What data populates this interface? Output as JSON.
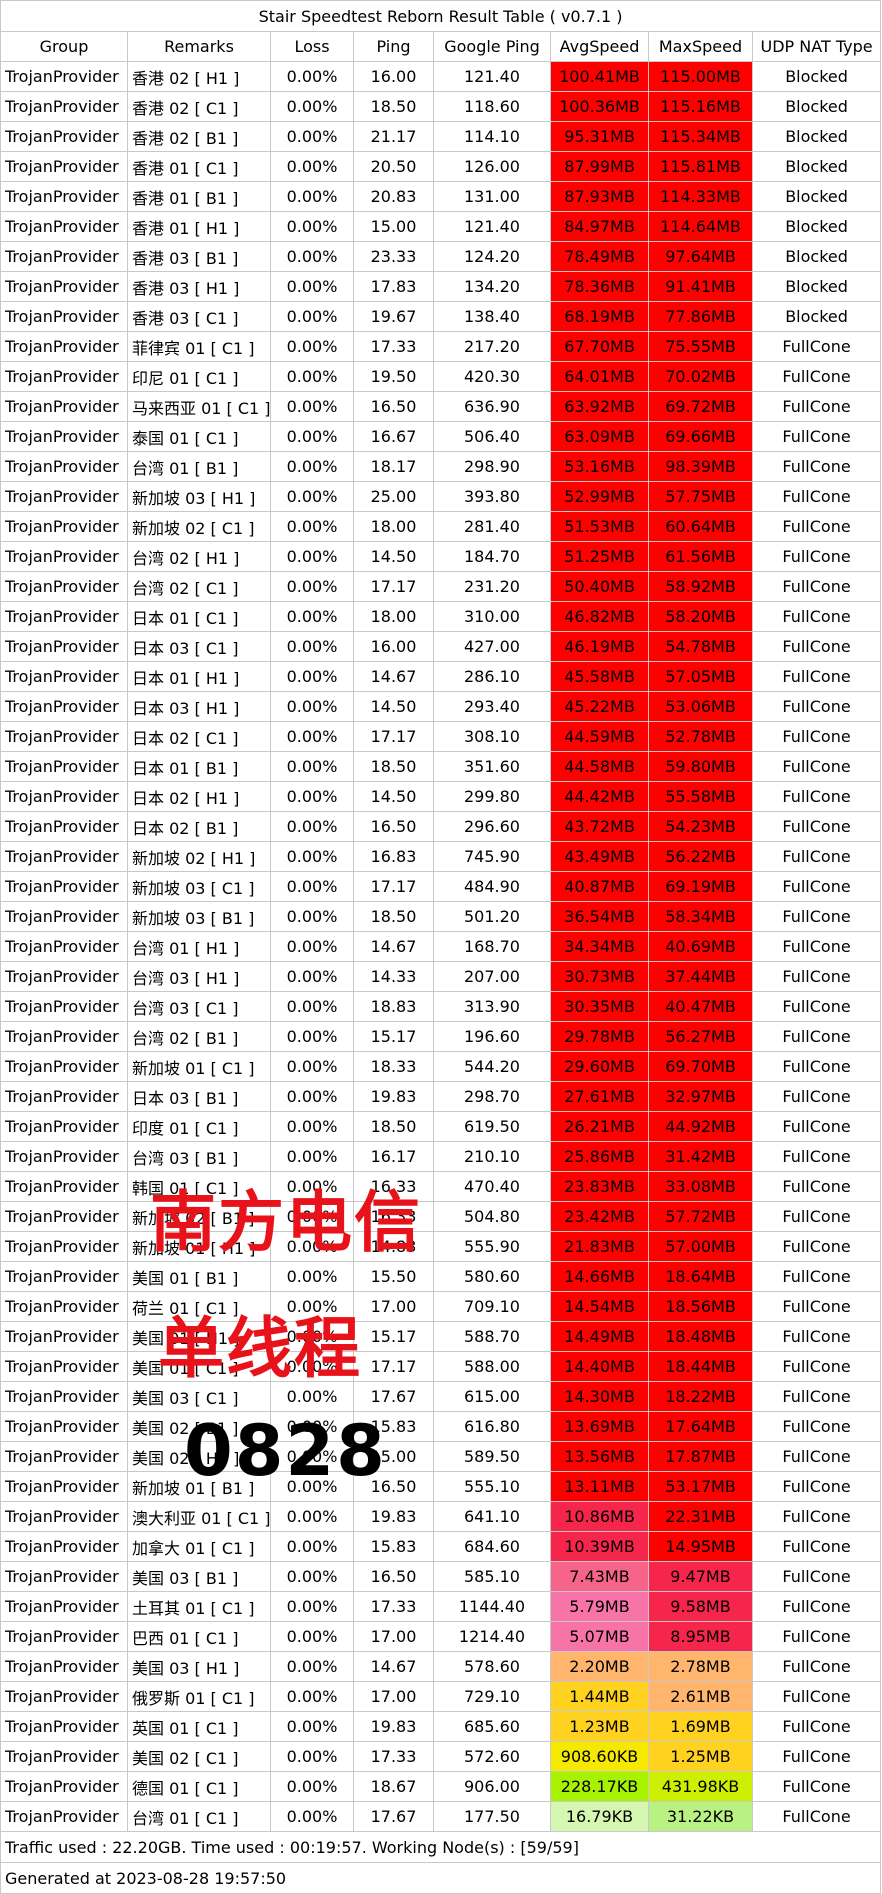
{
  "title": "Stair Speedtest Reborn Result Table ( v0.7.1 )",
  "columns": [
    "Group",
    "Remarks",
    "Loss",
    "Ping",
    "Google Ping",
    "AvgSpeed",
    "MaxSpeed",
    "UDP NAT Type"
  ],
  "rows": [
    {
      "group": "TrojanProvider",
      "remarks": "香港 02 [ H1 ]",
      "loss": "0.00%",
      "ping": "16.00",
      "gping": "121.40",
      "avg": "100.41MB",
      "max": "115.00MB",
      "nat": "Blocked",
      "avgColor": "#ff0000",
      "maxColor": "#ff0000"
    },
    {
      "group": "TrojanProvider",
      "remarks": "香港 02 [ C1 ]",
      "loss": "0.00%",
      "ping": "18.50",
      "gping": "118.60",
      "avg": "100.36MB",
      "max": "115.16MB",
      "nat": "Blocked",
      "avgColor": "#ff0000",
      "maxColor": "#ff0000"
    },
    {
      "group": "TrojanProvider",
      "remarks": "香港 02 [ B1 ]",
      "loss": "0.00%",
      "ping": "21.17",
      "gping": "114.10",
      "avg": "95.31MB",
      "max": "115.34MB",
      "nat": "Blocked",
      "avgColor": "#ff0000",
      "maxColor": "#ff0000"
    },
    {
      "group": "TrojanProvider",
      "remarks": "香港 01 [ C1 ]",
      "loss": "0.00%",
      "ping": "20.50",
      "gping": "126.00",
      "avg": "87.99MB",
      "max": "115.81MB",
      "nat": "Blocked",
      "avgColor": "#ff0000",
      "maxColor": "#ff0000"
    },
    {
      "group": "TrojanProvider",
      "remarks": "香港 01 [ B1 ]",
      "loss": "0.00%",
      "ping": "20.83",
      "gping": "131.00",
      "avg": "87.93MB",
      "max": "114.33MB",
      "nat": "Blocked",
      "avgColor": "#ff0000",
      "maxColor": "#ff0000"
    },
    {
      "group": "TrojanProvider",
      "remarks": "香港 01 [ H1 ]",
      "loss": "0.00%",
      "ping": "15.00",
      "gping": "121.40",
      "avg": "84.97MB",
      "max": "114.64MB",
      "nat": "Blocked",
      "avgColor": "#ff0000",
      "maxColor": "#ff0000"
    },
    {
      "group": "TrojanProvider",
      "remarks": "香港 03 [ B1 ]",
      "loss": "0.00%",
      "ping": "23.33",
      "gping": "124.20",
      "avg": "78.49MB",
      "max": "97.64MB",
      "nat": "Blocked",
      "avgColor": "#ff0000",
      "maxColor": "#ff0000"
    },
    {
      "group": "TrojanProvider",
      "remarks": "香港 03 [ H1 ]",
      "loss": "0.00%",
      "ping": "17.83",
      "gping": "134.20",
      "avg": "78.36MB",
      "max": "91.41MB",
      "nat": "Blocked",
      "avgColor": "#ff0000",
      "maxColor": "#ff0000"
    },
    {
      "group": "TrojanProvider",
      "remarks": "香港 03 [ C1 ]",
      "loss": "0.00%",
      "ping": "19.67",
      "gping": "138.40",
      "avg": "68.19MB",
      "max": "77.86MB",
      "nat": "Blocked",
      "avgColor": "#ff0000",
      "maxColor": "#ff0000"
    },
    {
      "group": "TrojanProvider",
      "remarks": "菲律宾 01 [ C1 ]",
      "loss": "0.00%",
      "ping": "17.33",
      "gping": "217.20",
      "avg": "67.70MB",
      "max": "75.55MB",
      "nat": "FullCone",
      "avgColor": "#ff0000",
      "maxColor": "#ff0000"
    },
    {
      "group": "TrojanProvider",
      "remarks": "印尼 01 [ C1 ]",
      "loss": "0.00%",
      "ping": "19.50",
      "gping": "420.30",
      "avg": "64.01MB",
      "max": "70.02MB",
      "nat": "FullCone",
      "avgColor": "#ff0000",
      "maxColor": "#ff0000"
    },
    {
      "group": "TrojanProvider",
      "remarks": "马来西亚 01 [ C1 ]",
      "loss": "0.00%",
      "ping": "16.50",
      "gping": "636.90",
      "avg": "63.92MB",
      "max": "69.72MB",
      "nat": "FullCone",
      "avgColor": "#ff0000",
      "maxColor": "#ff0000"
    },
    {
      "group": "TrojanProvider",
      "remarks": "泰国 01 [ C1 ]",
      "loss": "0.00%",
      "ping": "16.67",
      "gping": "506.40",
      "avg": "63.09MB",
      "max": "69.66MB",
      "nat": "FullCone",
      "avgColor": "#ff0000",
      "maxColor": "#ff0000"
    },
    {
      "group": "TrojanProvider",
      "remarks": "台湾 01 [ B1 ]",
      "loss": "0.00%",
      "ping": "18.17",
      "gping": "298.90",
      "avg": "53.16MB",
      "max": "98.39MB",
      "nat": "FullCone",
      "avgColor": "#ff0000",
      "maxColor": "#ff0000"
    },
    {
      "group": "TrojanProvider",
      "remarks": "新加坡 03 [ H1 ]",
      "loss": "0.00%",
      "ping": "25.00",
      "gping": "393.80",
      "avg": "52.99MB",
      "max": "57.75MB",
      "nat": "FullCone",
      "avgColor": "#ff0000",
      "maxColor": "#ff0000"
    },
    {
      "group": "TrojanProvider",
      "remarks": "新加坡 02 [ C1 ]",
      "loss": "0.00%",
      "ping": "18.00",
      "gping": "281.40",
      "avg": "51.53MB",
      "max": "60.64MB",
      "nat": "FullCone",
      "avgColor": "#ff0000",
      "maxColor": "#ff0000"
    },
    {
      "group": "TrojanProvider",
      "remarks": "台湾 02 [ H1 ]",
      "loss": "0.00%",
      "ping": "14.50",
      "gping": "184.70",
      "avg": "51.25MB",
      "max": "61.56MB",
      "nat": "FullCone",
      "avgColor": "#ff0000",
      "maxColor": "#ff0000"
    },
    {
      "group": "TrojanProvider",
      "remarks": "台湾 02 [ C1 ]",
      "loss": "0.00%",
      "ping": "17.17",
      "gping": "231.20",
      "avg": "50.40MB",
      "max": "58.92MB",
      "nat": "FullCone",
      "avgColor": "#ff0000",
      "maxColor": "#ff0000"
    },
    {
      "group": "TrojanProvider",
      "remarks": "日本 01 [ C1 ]",
      "loss": "0.00%",
      "ping": "18.00",
      "gping": "310.00",
      "avg": "46.82MB",
      "max": "58.20MB",
      "nat": "FullCone",
      "avgColor": "#ff0000",
      "maxColor": "#ff0000"
    },
    {
      "group": "TrojanProvider",
      "remarks": "日本 03 [ C1 ]",
      "loss": "0.00%",
      "ping": "16.00",
      "gping": "427.00",
      "avg": "46.19MB",
      "max": "54.78MB",
      "nat": "FullCone",
      "avgColor": "#ff0000",
      "maxColor": "#ff0000"
    },
    {
      "group": "TrojanProvider",
      "remarks": "日本 01 [ H1 ]",
      "loss": "0.00%",
      "ping": "14.67",
      "gping": "286.10",
      "avg": "45.58MB",
      "max": "57.05MB",
      "nat": "FullCone",
      "avgColor": "#ff0000",
      "maxColor": "#ff0000"
    },
    {
      "group": "TrojanProvider",
      "remarks": "日本 03 [ H1 ]",
      "loss": "0.00%",
      "ping": "14.50",
      "gping": "293.40",
      "avg": "45.22MB",
      "max": "53.06MB",
      "nat": "FullCone",
      "avgColor": "#ff0000",
      "maxColor": "#ff0000"
    },
    {
      "group": "TrojanProvider",
      "remarks": "日本 02 [ C1 ]",
      "loss": "0.00%",
      "ping": "17.17",
      "gping": "308.10",
      "avg": "44.59MB",
      "max": "52.78MB",
      "nat": "FullCone",
      "avgColor": "#ff0000",
      "maxColor": "#ff0000"
    },
    {
      "group": "TrojanProvider",
      "remarks": "日本 01 [ B1 ]",
      "loss": "0.00%",
      "ping": "18.50",
      "gping": "351.60",
      "avg": "44.58MB",
      "max": "59.80MB",
      "nat": "FullCone",
      "avgColor": "#ff0000",
      "maxColor": "#ff0000"
    },
    {
      "group": "TrojanProvider",
      "remarks": "日本 02 [ H1 ]",
      "loss": "0.00%",
      "ping": "14.50",
      "gping": "299.80",
      "avg": "44.42MB",
      "max": "55.58MB",
      "nat": "FullCone",
      "avgColor": "#ff0000",
      "maxColor": "#ff0000"
    },
    {
      "group": "TrojanProvider",
      "remarks": "日本 02 [ B1 ]",
      "loss": "0.00%",
      "ping": "16.50",
      "gping": "296.60",
      "avg": "43.72MB",
      "max": "54.23MB",
      "nat": "FullCone",
      "avgColor": "#ff0000",
      "maxColor": "#ff0000"
    },
    {
      "group": "TrojanProvider",
      "remarks": "新加坡 02 [ H1 ]",
      "loss": "0.00%",
      "ping": "16.83",
      "gping": "745.90",
      "avg": "43.49MB",
      "max": "56.22MB",
      "nat": "FullCone",
      "avgColor": "#ff0000",
      "maxColor": "#ff0000"
    },
    {
      "group": "TrojanProvider",
      "remarks": "新加坡 03 [ C1 ]",
      "loss": "0.00%",
      "ping": "17.17",
      "gping": "484.90",
      "avg": "40.87MB",
      "max": "69.19MB",
      "nat": "FullCone",
      "avgColor": "#ff0000",
      "maxColor": "#ff0000"
    },
    {
      "group": "TrojanProvider",
      "remarks": "新加坡 03 [ B1 ]",
      "loss": "0.00%",
      "ping": "18.50",
      "gping": "501.20",
      "avg": "36.54MB",
      "max": "58.34MB",
      "nat": "FullCone",
      "avgColor": "#ff0000",
      "maxColor": "#ff0000"
    },
    {
      "group": "TrojanProvider",
      "remarks": "台湾 01 [ H1 ]",
      "loss": "0.00%",
      "ping": "14.67",
      "gping": "168.70",
      "avg": "34.34MB",
      "max": "40.69MB",
      "nat": "FullCone",
      "avgColor": "#ff0000",
      "maxColor": "#ff0000"
    },
    {
      "group": "TrojanProvider",
      "remarks": "台湾 03 [ H1 ]",
      "loss": "0.00%",
      "ping": "14.33",
      "gping": "207.00",
      "avg": "30.73MB",
      "max": "37.44MB",
      "nat": "FullCone",
      "avgColor": "#ff0000",
      "maxColor": "#ff0000"
    },
    {
      "group": "TrojanProvider",
      "remarks": "台湾 03 [ C1 ]",
      "loss": "0.00%",
      "ping": "18.83",
      "gping": "313.90",
      "avg": "30.35MB",
      "max": "40.47MB",
      "nat": "FullCone",
      "avgColor": "#ff0000",
      "maxColor": "#ff0000"
    },
    {
      "group": "TrojanProvider",
      "remarks": "台湾 02 [ B1 ]",
      "loss": "0.00%",
      "ping": "15.17",
      "gping": "196.60",
      "avg": "29.78MB",
      "max": "56.27MB",
      "nat": "FullCone",
      "avgColor": "#ff0000",
      "maxColor": "#ff0000"
    },
    {
      "group": "TrojanProvider",
      "remarks": "新加坡 01 [ C1 ]",
      "loss": "0.00%",
      "ping": "18.33",
      "gping": "544.20",
      "avg": "29.60MB",
      "max": "69.70MB",
      "nat": "FullCone",
      "avgColor": "#ff0000",
      "maxColor": "#ff0000"
    },
    {
      "group": "TrojanProvider",
      "remarks": "日本 03 [ B1 ]",
      "loss": "0.00%",
      "ping": "19.83",
      "gping": "298.70",
      "avg": "27.61MB",
      "max": "32.97MB",
      "nat": "FullCone",
      "avgColor": "#ff0000",
      "maxColor": "#ff0000"
    },
    {
      "group": "TrojanProvider",
      "remarks": "印度 01 [ C1 ]",
      "loss": "0.00%",
      "ping": "18.50",
      "gping": "619.50",
      "avg": "26.21MB",
      "max": "44.92MB",
      "nat": "FullCone",
      "avgColor": "#ff0000",
      "maxColor": "#ff0000"
    },
    {
      "group": "TrojanProvider",
      "remarks": "台湾 03 [ B1 ]",
      "loss": "0.00%",
      "ping": "16.17",
      "gping": "210.10",
      "avg": "25.86MB",
      "max": "31.42MB",
      "nat": "FullCone",
      "avgColor": "#ff0000",
      "maxColor": "#ff0000"
    },
    {
      "group": "TrojanProvider",
      "remarks": "韩国 01 [ C1 ]",
      "loss": "0.00%",
      "ping": "16.33",
      "gping": "470.40",
      "avg": "23.83MB",
      "max": "33.08MB",
      "nat": "FullCone",
      "avgColor": "#ff0000",
      "maxColor": "#ff0000"
    },
    {
      "group": "TrojanProvider",
      "remarks": "新加坡 02 [ B1 ]",
      "loss": "0.00%",
      "ping": "16.33",
      "gping": "504.80",
      "avg": "23.42MB",
      "max": "57.72MB",
      "nat": "FullCone",
      "avgColor": "#ff0000",
      "maxColor": "#ff0000"
    },
    {
      "group": "TrojanProvider",
      "remarks": "新加坡 01 [ H1 ]",
      "loss": "0.00%",
      "ping": "14.83",
      "gping": "555.90",
      "avg": "21.83MB",
      "max": "57.00MB",
      "nat": "FullCone",
      "avgColor": "#ff0000",
      "maxColor": "#ff0000"
    },
    {
      "group": "TrojanProvider",
      "remarks": "美国 01 [ B1 ]",
      "loss": "0.00%",
      "ping": "15.50",
      "gping": "580.60",
      "avg": "14.66MB",
      "max": "18.64MB",
      "nat": "FullCone",
      "avgColor": "#ff0000",
      "maxColor": "#ff0000"
    },
    {
      "group": "TrojanProvider",
      "remarks": "荷兰 01 [ C1 ]",
      "loss": "0.00%",
      "ping": "17.00",
      "gping": "709.10",
      "avg": "14.54MB",
      "max": "18.56MB",
      "nat": "FullCone",
      "avgColor": "#ff0000",
      "maxColor": "#ff0000"
    },
    {
      "group": "TrojanProvider",
      "remarks": "美国 01 [ H1 ]",
      "loss": "0.00%",
      "ping": "15.17",
      "gping": "588.70",
      "avg": "14.49MB",
      "max": "18.48MB",
      "nat": "FullCone",
      "avgColor": "#ff0000",
      "maxColor": "#ff0000"
    },
    {
      "group": "TrojanProvider",
      "remarks": "美国 01 [ C1 ]",
      "loss": "0.00%",
      "ping": "17.17",
      "gping": "588.00",
      "avg": "14.40MB",
      "max": "18.44MB",
      "nat": "FullCone",
      "avgColor": "#ff0000",
      "maxColor": "#ff0000"
    },
    {
      "group": "TrojanProvider",
      "remarks": "美国 03 [ C1 ]",
      "loss": "0.00%",
      "ping": "17.67",
      "gping": "615.00",
      "avg": "14.30MB",
      "max": "18.22MB",
      "nat": "FullCone",
      "avgColor": "#ff0000",
      "maxColor": "#ff0000"
    },
    {
      "group": "TrojanProvider",
      "remarks": "美国 02 [ B1 ]",
      "loss": "0.00%",
      "ping": "15.83",
      "gping": "616.80",
      "avg": "13.69MB",
      "max": "17.64MB",
      "nat": "FullCone",
      "avgColor": "#ff0000",
      "maxColor": "#ff0000"
    },
    {
      "group": "TrojanProvider",
      "remarks": "美国 02 [ H1 ]",
      "loss": "0.00%",
      "ping": "15.00",
      "gping": "589.50",
      "avg": "13.56MB",
      "max": "17.87MB",
      "nat": "FullCone",
      "avgColor": "#ff0000",
      "maxColor": "#ff0000"
    },
    {
      "group": "TrojanProvider",
      "remarks": "新加坡 01 [ B1 ]",
      "loss": "0.00%",
      "ping": "16.50",
      "gping": "555.10",
      "avg": "13.11MB",
      "max": "53.17MB",
      "nat": "FullCone",
      "avgColor": "#ff0000",
      "maxColor": "#ff0000"
    },
    {
      "group": "TrojanProvider",
      "remarks": "澳大利亚 01 [ C1 ]",
      "loss": "0.00%",
      "ping": "19.83",
      "gping": "641.10",
      "avg": "10.86MB",
      "max": "22.31MB",
      "nat": "FullCone",
      "avgColor": "#f5254b",
      "maxColor": "#ff0000"
    },
    {
      "group": "TrojanProvider",
      "remarks": "加拿大 01 [ C1 ]",
      "loss": "0.00%",
      "ping": "15.83",
      "gping": "684.60",
      "avg": "10.39MB",
      "max": "14.95MB",
      "nat": "FullCone",
      "avgColor": "#f5254b",
      "maxColor": "#ff0000"
    },
    {
      "group": "TrojanProvider",
      "remarks": "美国 03 [ B1 ]",
      "loss": "0.00%",
      "ping": "16.50",
      "gping": "585.10",
      "avg": "7.43MB",
      "max": "9.47MB",
      "nat": "FullCone",
      "avgColor": "#f7648a",
      "maxColor": "#f5254b"
    },
    {
      "group": "TrojanProvider",
      "remarks": "土耳其 01 [ C1 ]",
      "loss": "0.00%",
      "ping": "17.33",
      "gping": "1144.40",
      "avg": "5.79MB",
      "max": "9.58MB",
      "nat": "FullCone",
      "avgColor": "#f773a8",
      "maxColor": "#f5254b"
    },
    {
      "group": "TrojanProvider",
      "remarks": "巴西 01 [ C1 ]",
      "loss": "0.00%",
      "ping": "17.00",
      "gping": "1214.40",
      "avg": "5.07MB",
      "max": "8.95MB",
      "nat": "FullCone",
      "avgColor": "#f773a8",
      "maxColor": "#f5254b"
    },
    {
      "group": "TrojanProvider",
      "remarks": "美国 03 [ H1 ]",
      "loss": "0.00%",
      "ping": "14.67",
      "gping": "578.60",
      "avg": "2.20MB",
      "max": "2.78MB",
      "nat": "FullCone",
      "avgColor": "#ffb56b",
      "maxColor": "#ffb56b"
    },
    {
      "group": "TrojanProvider",
      "remarks": "俄罗斯 01 [ C1 ]",
      "loss": "0.00%",
      "ping": "17.00",
      "gping": "729.10",
      "avg": "1.44MB",
      "max": "2.61MB",
      "nat": "FullCone",
      "avgColor": "#ffd21f",
      "maxColor": "#ffb56b"
    },
    {
      "group": "TrojanProvider",
      "remarks": "英国 01 [ C1 ]",
      "loss": "0.00%",
      "ping": "19.83",
      "gping": "685.60",
      "avg": "1.23MB",
      "max": "1.69MB",
      "nat": "FullCone",
      "avgColor": "#ffd21f",
      "maxColor": "#ffd21f"
    },
    {
      "group": "TrojanProvider",
      "remarks": "美国 02 [ C1 ]",
      "loss": "0.00%",
      "ping": "17.33",
      "gping": "572.60",
      "avg": "908.60KB",
      "max": "1.25MB",
      "nat": "FullCone",
      "avgColor": "#f5e900",
      "maxColor": "#ffd21f"
    },
    {
      "group": "TrojanProvider",
      "remarks": "德国 01 [ C1 ]",
      "loss": "0.00%",
      "ping": "18.67",
      "gping": "906.00",
      "avg": "228.17KB",
      "max": "431.98KB",
      "nat": "FullCone",
      "avgColor": "#a6f200",
      "maxColor": "#cdf000"
    },
    {
      "group": "TrojanProvider",
      "remarks": "台湾 01 [ C1 ]",
      "loss": "0.00%",
      "ping": "17.67",
      "gping": "177.50",
      "avg": "16.79KB",
      "max": "31.22KB",
      "nat": "FullCone",
      "avgColor": "#d6f7b2",
      "maxColor": "#b9f283"
    }
  ],
  "footer": {
    "traffic": "Traffic used : 22.20GB. Time used : 00:19:57. Working Node(s) : [59/59]",
    "generated": "Generated at 2023-08-28 19:57:50"
  },
  "watermark": {
    "line1": "南方电信",
    "line2": "单线程",
    "line3": "0828"
  }
}
